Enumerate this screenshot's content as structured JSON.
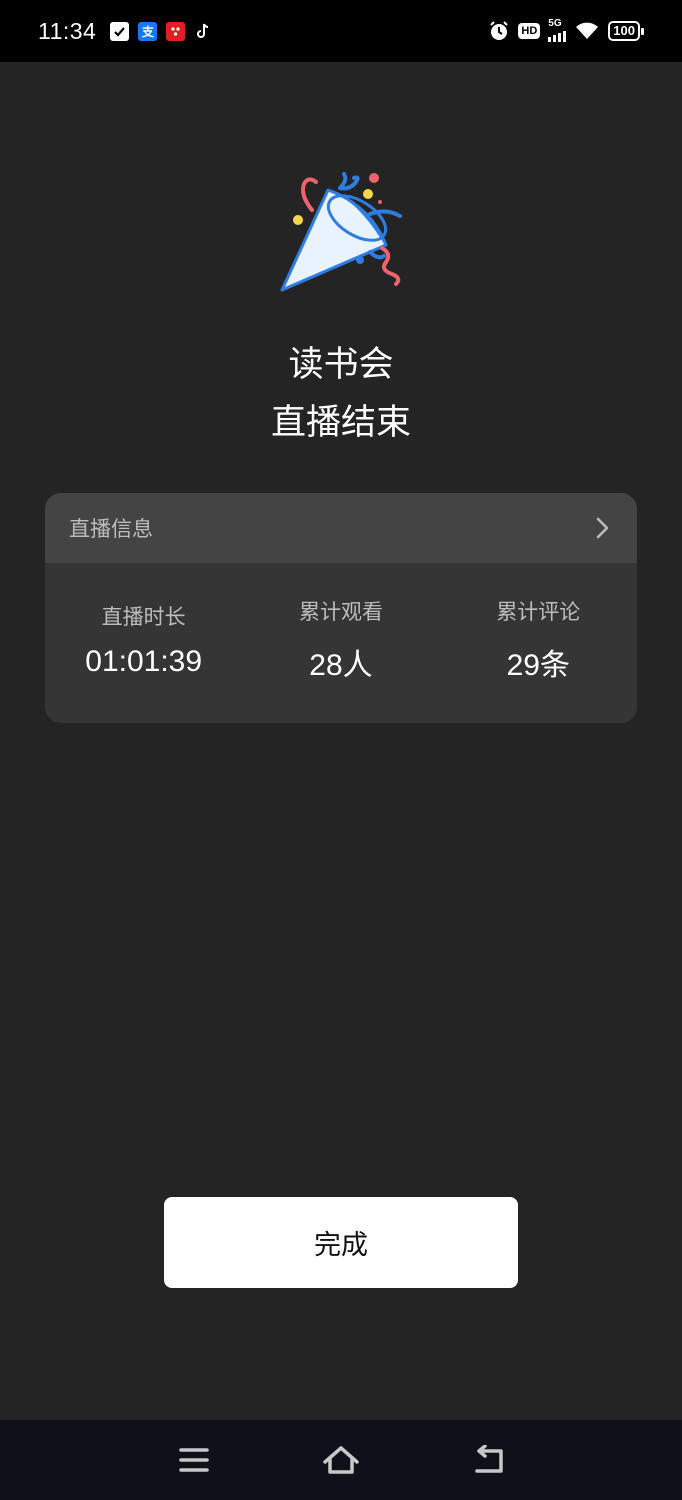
{
  "status_bar": {
    "time": "11:34",
    "left_icons": [
      "check-app-icon",
      "alipay-icon",
      "red-app-icon",
      "tiktok-icon"
    ],
    "alipay_label": "支",
    "hd_label": "HD",
    "network": "5G",
    "battery": "100"
  },
  "title": {
    "line1": "读书会",
    "line2": "直播结束"
  },
  "card": {
    "header_label": "直播信息",
    "stats": [
      {
        "label": "直播时长",
        "value": "01:01:39"
      },
      {
        "label": "累计观看",
        "value": "28人"
      },
      {
        "label": "累计评论",
        "value": "29条"
      }
    ]
  },
  "done_button": {
    "label": "完成"
  },
  "colors": {
    "background": "#242424",
    "card": "#353535",
    "card_header": "#444444",
    "button": "#ffffff",
    "nav_bar": "#0f111a",
    "popper_blue": "#2f7de1",
    "popper_red": "#f0636e",
    "popper_yellow": "#f7d64a"
  }
}
